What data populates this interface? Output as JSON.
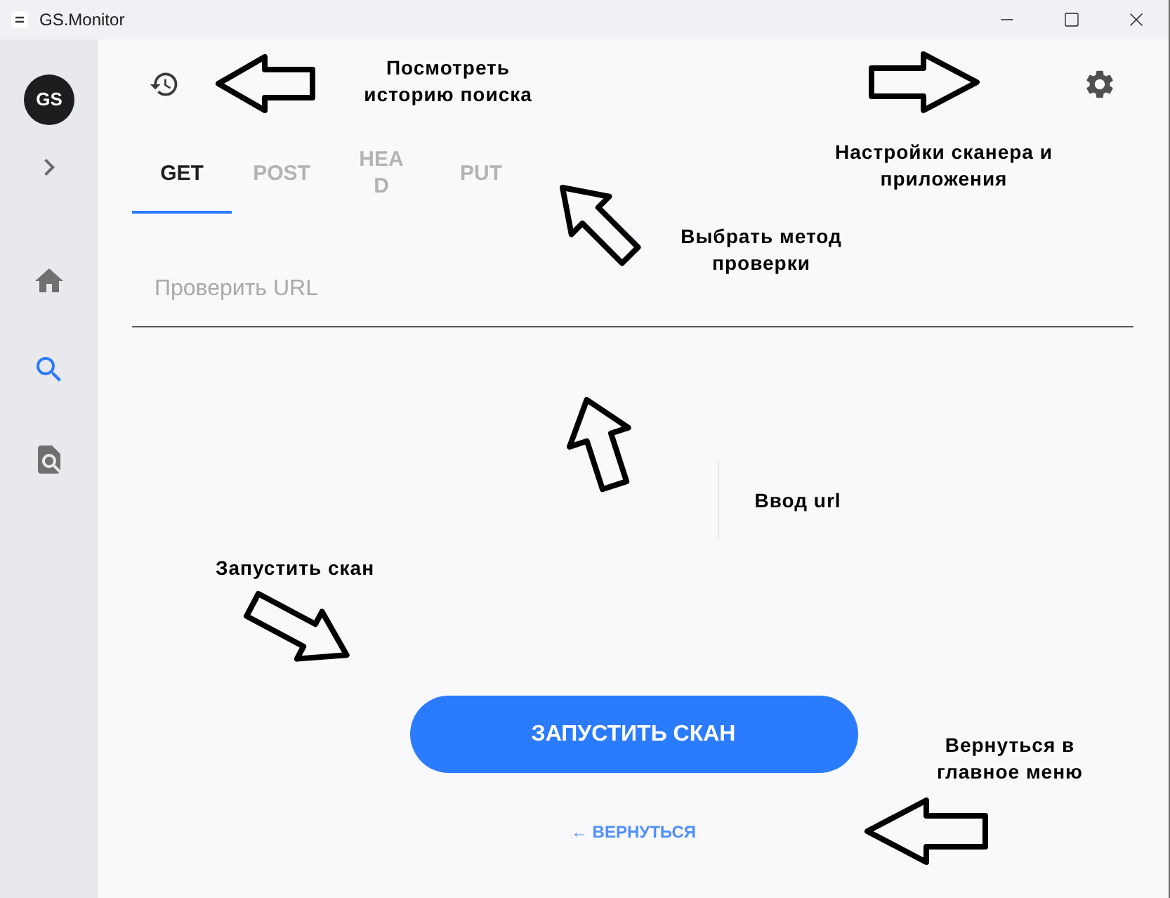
{
  "window": {
    "title": "GS.Monitor"
  },
  "sidebar": {
    "avatar": "GS",
    "items": [
      {
        "kind": "home",
        "selected": false
      },
      {
        "kind": "search",
        "selected": true
      },
      {
        "kind": "report",
        "selected": false
      }
    ]
  },
  "tabs": [
    {
      "label": "GET",
      "selected": true
    },
    {
      "label": "POST",
      "selected": false
    },
    {
      "label": "HEAD",
      "selected": false
    },
    {
      "label": "PUT",
      "selected": false
    }
  ],
  "url_field": {
    "placeholder": "Проверить URL"
  },
  "scan_button": {
    "label": "ЗАПУСТИТЬ СКАН"
  },
  "back_link": {
    "label": "← ВЕРНУТЬСЯ"
  },
  "annotations": [
    {
      "text": "Посмотреть\nисторию поиска",
      "kind": "left"
    },
    {
      "text": "Настройки сканера и\nприложения",
      "kind": "right"
    },
    {
      "text": "Выбрать метод\nпроверки",
      "kind": "upleft"
    },
    {
      "text": "Ввод url",
      "kind": "up"
    },
    {
      "text": "Запустить скан",
      "kind": "downright"
    },
    {
      "text": "Вернуться в\nглавное меню",
      "kind": "left"
    }
  ]
}
